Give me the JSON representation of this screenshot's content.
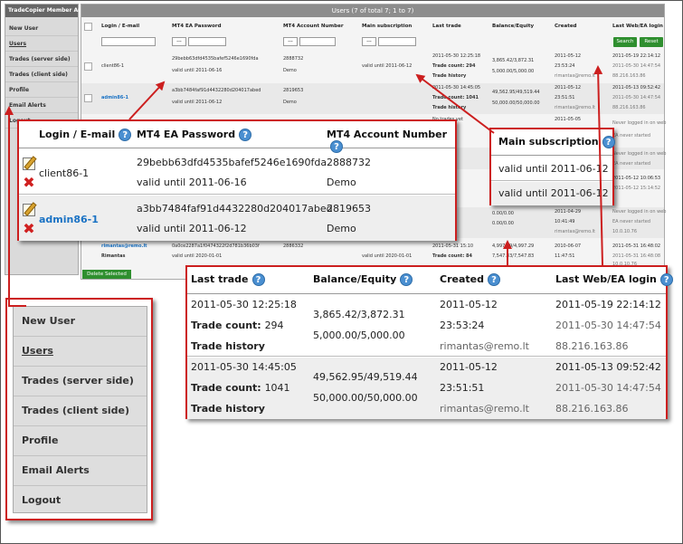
{
  "app": {
    "brand": "TradeCopier Member Area",
    "nav": [
      "New User",
      "Users",
      "Trades (server side)",
      "Trades (client side)",
      "Profile",
      "Email Alerts",
      "Logout"
    ],
    "active_nav": "Users",
    "caption": "Users (7 of total 7; 1 to 7)",
    "columns": [
      "Login / E-mail",
      "MT4 EA Password",
      "MT4 Account Number",
      "Main subscription",
      "Last trade",
      "Balance/Equity",
      "Created",
      "Last Web/EA login"
    ],
    "filter_select": "---",
    "search_label": "Search",
    "reset_label": "Reset",
    "delete_selected_label": "Delete Selected",
    "bg_rows": [
      {
        "login": "client86-1",
        "pass": "29bebb63dfd4535bafef5246e1690fda",
        "pass_valid": "valid until 2011-06-16",
        "acct": "2888732",
        "acct_type": "Demo",
        "sub": "valid until 2011-06-12",
        "last_trade": "2011-05-30 12:25:18",
        "count": "Trade count: 294",
        "history": "Trade history",
        "bal1": "3,865.42/3,872.31",
        "bal2": "5,000.00/5,000.00",
        "created1": "2011-05-12",
        "created2": "23:53:24",
        "email": "rimantas@remo.lt",
        "login1": "2011-05-19 22:14:12",
        "login2": "2011-05-30 14:47:54",
        "ip": "88.216.163.86"
      },
      {
        "login": "admin86-1",
        "pass": "a3bb7484faf91d4432280d204017abed",
        "pass_valid": "valid until 2011-06-12",
        "acct": "2819653",
        "acct_type": "Demo",
        "sub": "",
        "last_trade": "2011-05-30 14:45:05",
        "count": "Trade count: 1041",
        "history": "Trade history",
        "bal1": "49,562.95/49,519.44",
        "bal2": "50,000.00/50,000.00",
        "created1": "2011-05-12",
        "created2": "23:51:51",
        "email": "rimantas@remo.lt",
        "login1": "2011-05-13 09:52:42",
        "login2": "2011-05-30 14:47:54",
        "ip": "88.216.163.86"
      }
    ],
    "bg_partial": [
      {
        "a": "No trades yet",
        "b": "0.00/0.00",
        "c": "2011-05-05",
        "d": "Never logged in on web"
      },
      {
        "a": "",
        "b": "",
        "c": "",
        "d": "EA never started"
      },
      {
        "a": "",
        "b": "",
        "c": "",
        "d": "Never logged in on web"
      },
      {
        "a": "",
        "b": "",
        "c": "",
        "d": "EA never started"
      },
      {
        "a": "",
        "b": "",
        "c": "",
        "d": "2011-05-12 10:06:53"
      },
      {
        "a": "",
        "b": "",
        "c": "",
        "d": "2011-05-12 15:14:52"
      },
      {
        "a": "",
        "b": "0.00/0.00",
        "c": "2011-04-29",
        "d": "Never logged in on web"
      },
      {
        "a": "",
        "b": "0.00/0.00",
        "c": "10:41:49",
        "d": "EA never started"
      },
      {
        "a": "",
        "b": "",
        "c": "rimantas@remo.lt",
        "d": "10.0.10.76"
      }
    ],
    "bg_last": {
      "login": "rimantas@remo.lt",
      "login2": "Rimantas",
      "pass": "0a0ce2287a1f0474322f2d781b36b03f",
      "pass_valid": "valid until 2020-01-01",
      "acct": "2886332",
      "sub": "valid until 2020-01-01",
      "last": "2011-05-31 15:10",
      "count": "Trade count: 84",
      "bal1": "4,997.29/4,997.29",
      "bal2": "7,547.83/7,547.83",
      "created1": "2010-06-07",
      "created2": "11:47:51",
      "login1": "2011-05-31 16:48:02",
      "login2b": "2011-05-31 16:48:08",
      "ip": "10.0.10.76"
    }
  },
  "login_callout": {
    "headers": [
      "Login / E-mail",
      "MT4 EA Password",
      "MT4 Account Number"
    ],
    "rows": [
      {
        "login": "client86-1",
        "password": "29bebb63dfd4535bafef5246e1690fda",
        "valid": "valid until 2011-06-16",
        "account": "2888732",
        "type": "Demo"
      },
      {
        "login": "admin86-1",
        "password": "a3bb7484faf91d4432280d204017abed",
        "valid": "valid until 2011-06-12",
        "account": "2819653",
        "type": "Demo"
      }
    ]
  },
  "subscription_callout": {
    "header": "Main subscription",
    "rows": [
      "valid until 2011-06-12",
      "valid until 2011-06-12"
    ]
  },
  "trade_callout": {
    "headers": [
      "Last trade",
      "Balance/Equity",
      "Created",
      "Last Web/EA login"
    ],
    "rows": [
      {
        "last_trade": "2011-05-30 12:25:18",
        "count_label": "Trade count:",
        "count": "294",
        "history": "Trade history",
        "balance": "3,865.42/3,872.31",
        "equity_base": "5,000.00/5,000.00",
        "created_date": "2011-05-12",
        "created_time": "23:53:24",
        "email": "rimantas@remo.lt",
        "web_login": "2011-05-19 22:14:12",
        "ea_login": "2011-05-30 14:47:54",
        "ip": "88.216.163.86"
      },
      {
        "last_trade": "2011-05-30 14:45:05",
        "count_label": "Trade count:",
        "count": "1041",
        "history": "Trade history",
        "balance": "49,562.95/49,519.44",
        "equity_base": "50,000.00/50,000.00",
        "created_date": "2011-05-12",
        "created_time": "23:51:51",
        "email": "rimantas@remo.lt",
        "web_login": "2011-05-13 09:52:42",
        "ea_login": "2011-05-30 14:47:54",
        "ip": "88.216.163.86"
      }
    ]
  },
  "nav_callout": {
    "items": [
      "New User",
      "Users",
      "Trades (server side)",
      "Trades (client side)",
      "Profile",
      "Email Alerts",
      "Logout"
    ]
  },
  "colors": {
    "callout_border": "#cc1f1f",
    "help_icon": "#4a8fd1",
    "button_green": "#2f8f2f",
    "link_blue": "#1a72c4"
  },
  "icons": [
    "help-icon",
    "edit-icon",
    "delete-icon",
    "checkbox"
  ]
}
